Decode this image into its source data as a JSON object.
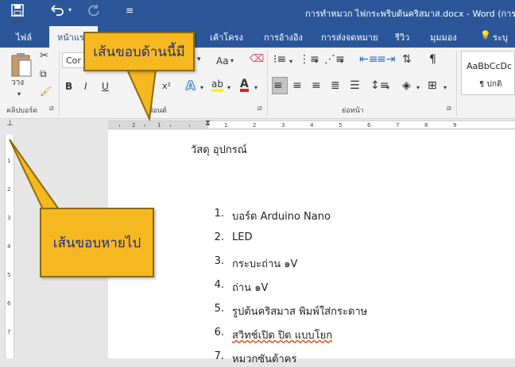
{
  "title_bar": {
    "save_icon": "save-icon",
    "undo_icon": "undo-icon",
    "redo_icon": "redo-icon",
    "customize_icon": "customize-qat-icon",
    "document_title": "การทำหมวก ไฟกระพริบต้นคริสมาส.docx - Word (การเปิ"
  },
  "ribbon_tabs": {
    "file": "ไฟล์",
    "home": "หน้าแรก",
    "layout": "เค้าโครง",
    "references": "การอ้างอิง",
    "mailings": "การส่งจดหมาย",
    "review": "รีวิว",
    "view": "มุมมอง",
    "tell_me": "ระบุ"
  },
  "ribbon": {
    "clipboard": {
      "paste_label": "วาง",
      "group_label": "คลิปบอร์ด"
    },
    "font": {
      "font_name": "Cor",
      "change_case": "Aa",
      "bold": "B",
      "italic": "I",
      "underline": "U",
      "subscript": "x₂",
      "superscript": "x²",
      "text_effects": "A",
      "highlight": "ab",
      "font_color": "A",
      "group_label": "ฟอนต์"
    },
    "paragraph": {
      "group_label": "ย่อหน้า"
    },
    "styles": {
      "style_preview": "AaBbCcDc",
      "style_name": "¶ ปกติ"
    }
  },
  "ruler": {
    "tab_selector": "⊥",
    "numbers": [
      "2",
      "1",
      "1",
      "2",
      "3",
      "4",
      "5",
      "6",
      "7",
      "8",
      "9"
    ],
    "v_numbers": [
      "1",
      "2",
      "3",
      "4",
      "5",
      "6",
      "7"
    ]
  },
  "document": {
    "heading": "วัสดุ อุปกรณ์",
    "list": [
      {
        "num": "1.",
        "text": "บอร์ด Arduino Nano"
      },
      {
        "num": "2.",
        "text": "LED"
      },
      {
        "num": "3.",
        "text": "กระบะถ่าน ๑V"
      },
      {
        "num": "4.",
        "text": "ถ่าน ๑V"
      },
      {
        "num": "5.",
        "text": "รูปต้นคริสมาส พิมพ์ใส่กระดาษ"
      },
      {
        "num": "6.",
        "text": "สวิทช์เปิด ปิด แบบโยก"
      },
      {
        "num": "7.",
        "text": "หมวกซันต้าคร"
      }
    ]
  },
  "annotations": {
    "top_callout": "เส้นขอบด้านนี้มี",
    "left_callout": "เส้นขอบหายไป"
  },
  "colors": {
    "word_blue": "#2b579a",
    "callout_fill": "#f5b821",
    "callout_text": "#1f2a8a"
  }
}
